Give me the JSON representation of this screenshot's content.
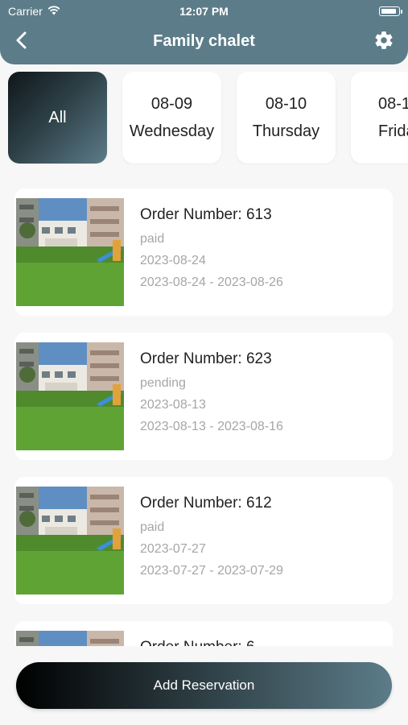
{
  "status_bar": {
    "carrier": "Carrier",
    "time": "12:07 PM"
  },
  "header": {
    "title": "Family chalet",
    "back_icon": "chevron-left-icon",
    "settings_icon": "gear-icon"
  },
  "date_filters": [
    {
      "label": "All",
      "selected": true
    },
    {
      "date": "08-09",
      "day": "Wednesday",
      "selected": false
    },
    {
      "date": "08-10",
      "day": "Thursday",
      "selected": false
    },
    {
      "date": "08-1",
      "day": "Frida",
      "selected": false
    }
  ],
  "orders": [
    {
      "title": "Order Number: 613",
      "status": "paid",
      "date": "2023-08-24",
      "range": "2023-08-24 - 2023-08-26"
    },
    {
      "title": "Order Number: 623",
      "status": "pending",
      "date": "2023-08-13",
      "range": "2023-08-13 - 2023-08-16"
    },
    {
      "title": "Order Number: 612",
      "status": "paid",
      "date": "2023-07-27",
      "range": "2023-07-27 - 2023-07-29"
    },
    {
      "title": "Order Number: 6",
      "status": "",
      "date": "",
      "range": ""
    }
  ],
  "add_button": {
    "label": "Add Reservation"
  },
  "colors": {
    "header": "#5c7c89",
    "muted_text": "#a6a6a6",
    "background": "#f7f7f7"
  }
}
